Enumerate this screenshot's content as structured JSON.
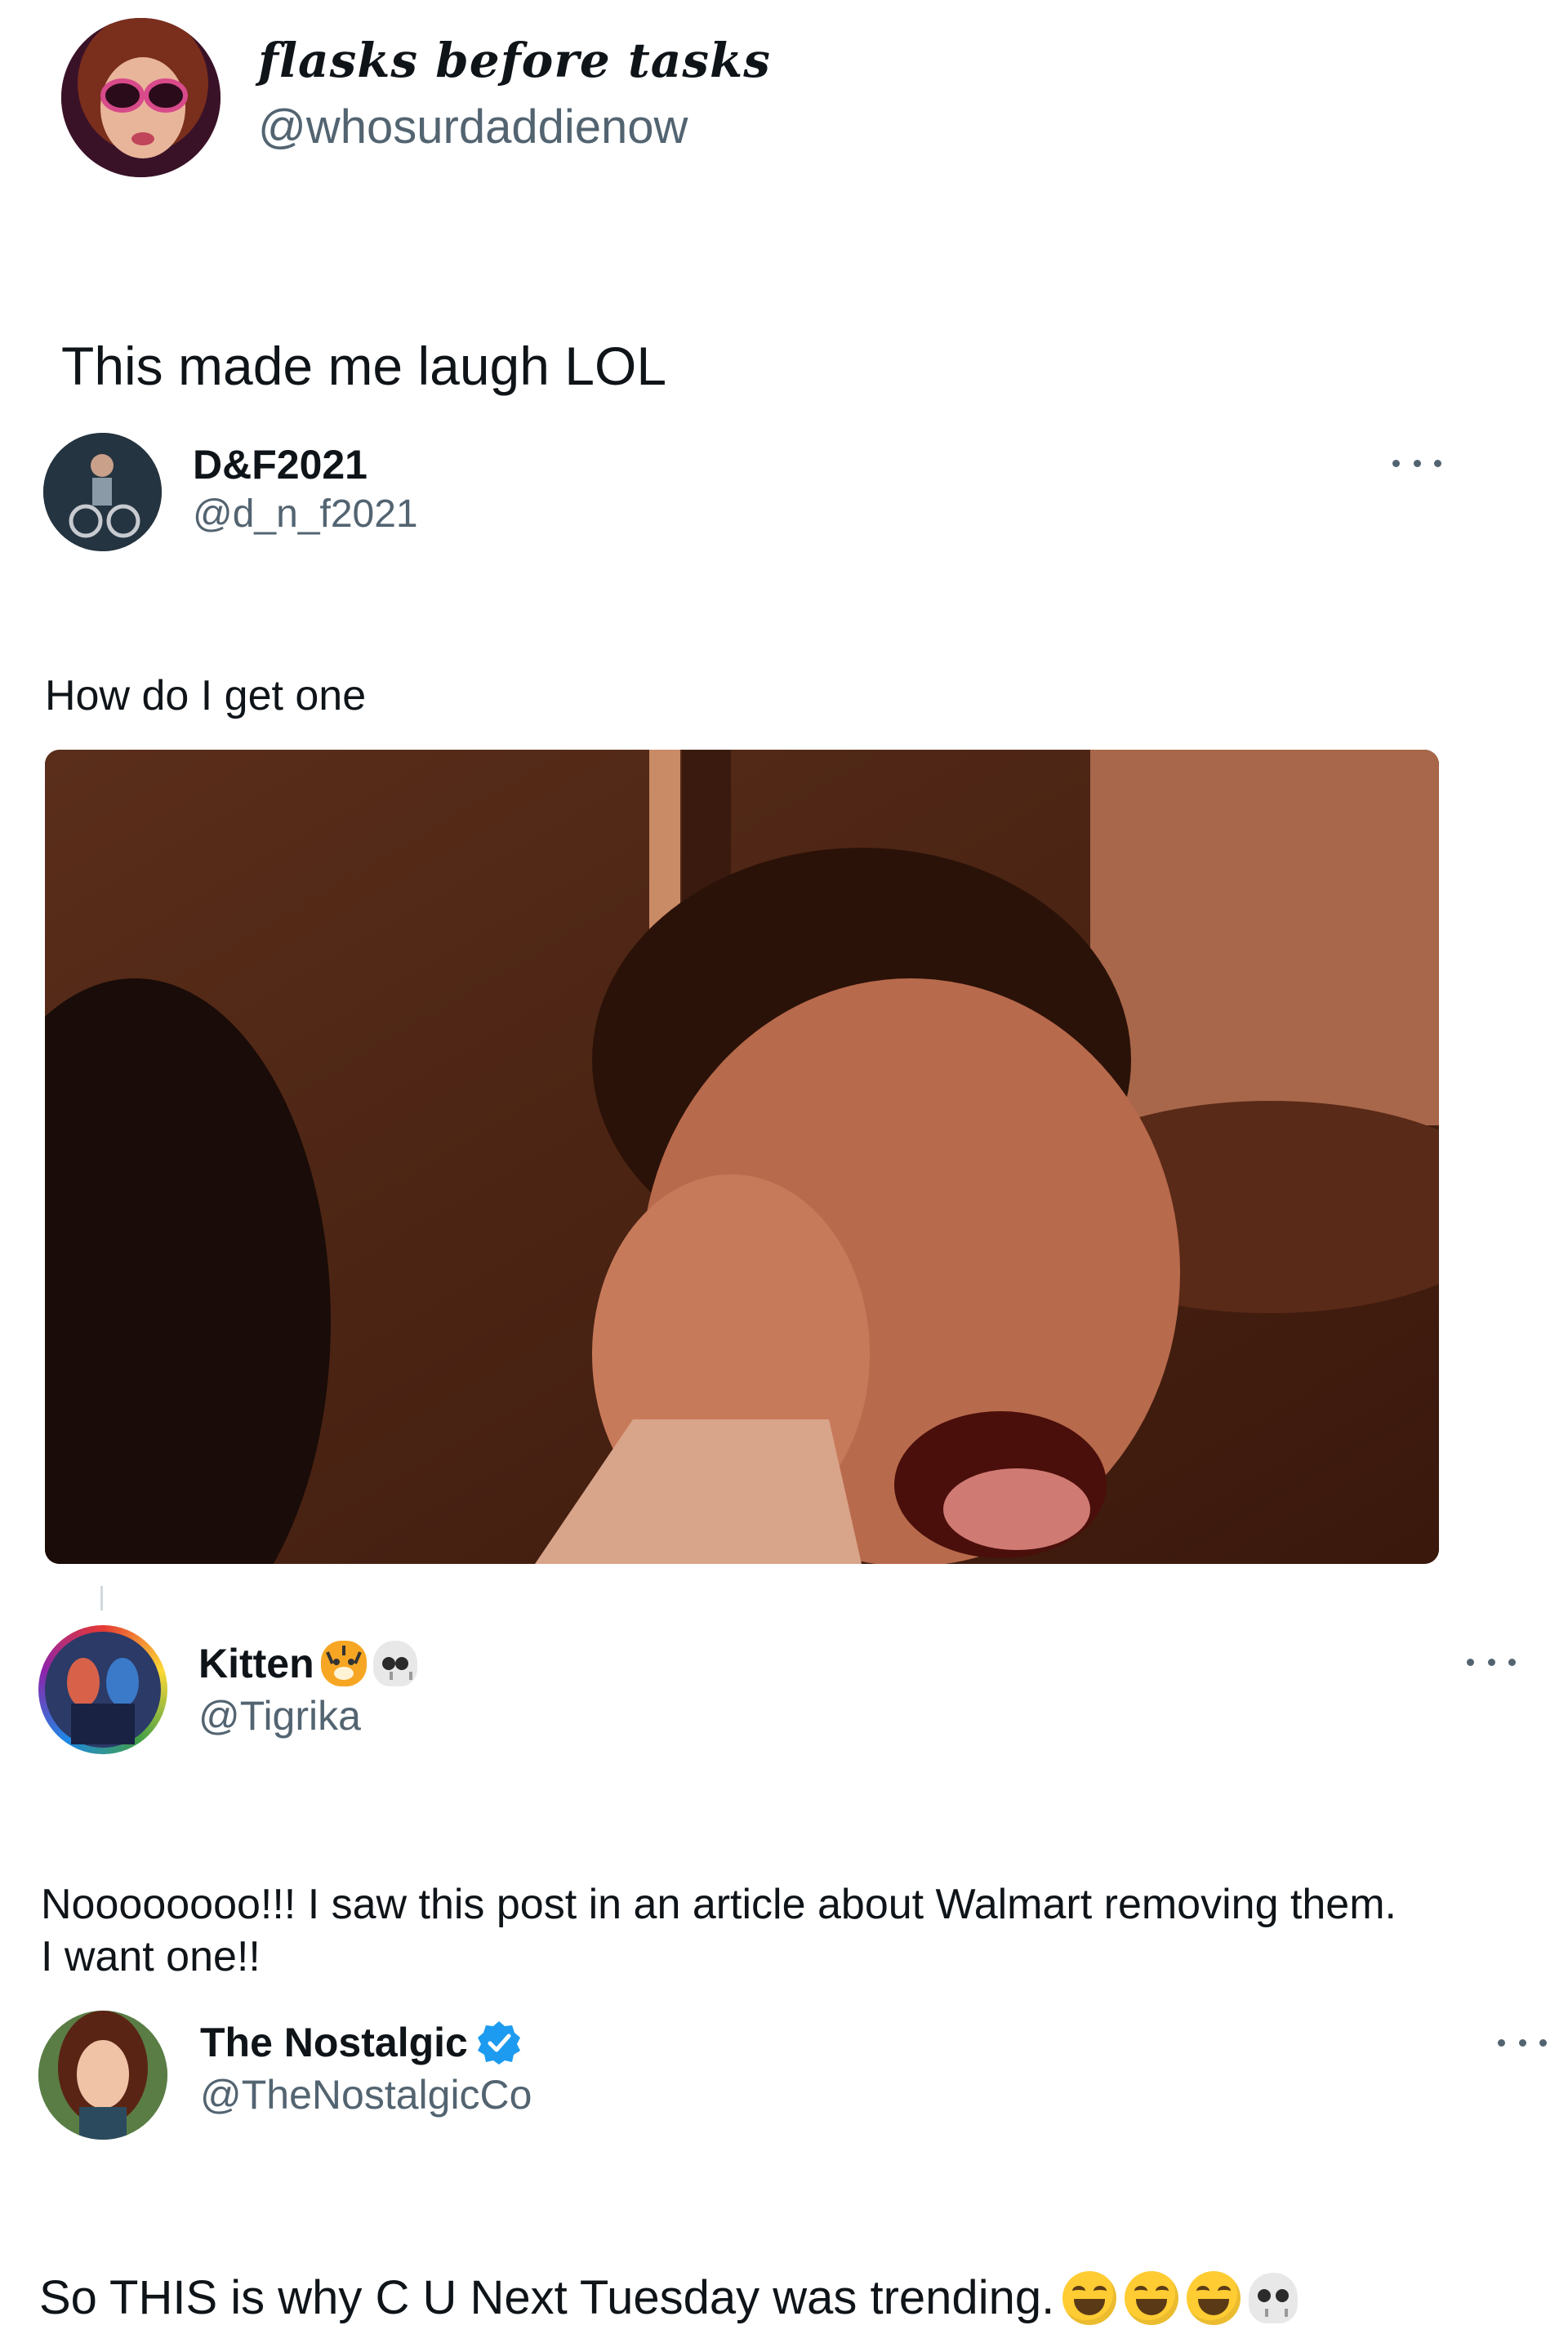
{
  "post": {
    "display_name": "flasks before tasks",
    "handle": "@whosurdaddienow",
    "text": "This made me laugh LOL"
  },
  "quoted_1": {
    "display_name": "D&F2021",
    "handle": "@d_n_f2021",
    "text": "How do I get one",
    "more_icon": "more-horizontal-icon"
  },
  "quoted_2": {
    "display_name": "Kitten",
    "name_emojis": [
      "tiger-face-emoji",
      "skull-emoji"
    ],
    "handle": "@Tigrika",
    "text_line1": "Noooooooo!!! I saw this post in an article about Walmart removing them.",
    "text_line2": "I want one!!"
  },
  "quoted_3": {
    "display_name": "The Nostalgic",
    "verified_icon": "verified-badge-icon",
    "handle": "@TheNostalgicCo",
    "text": "So THIS is why C U Next Tuesday was trending.",
    "trailing_emojis": [
      "laughing-emoji",
      "laughing-emoji",
      "laughing-emoji",
      "skull-emoji"
    ]
  },
  "colors": {
    "text_primary": "#0f1419",
    "text_secondary": "#536471",
    "verified_blue": "#1d9bf0"
  }
}
